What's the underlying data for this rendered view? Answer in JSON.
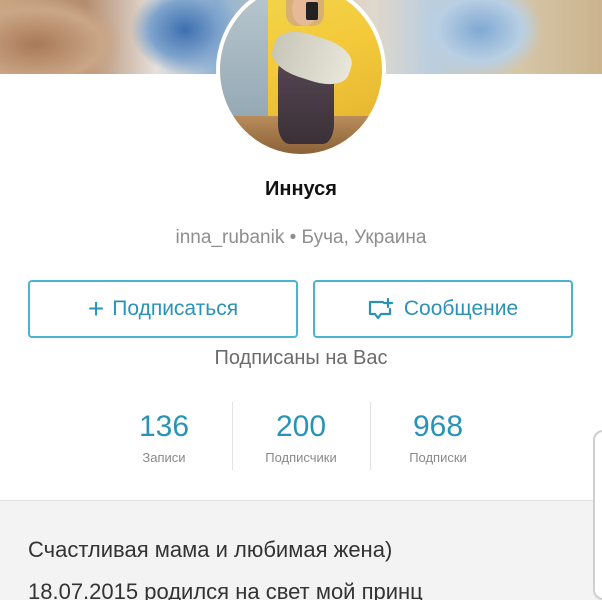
{
  "profile": {
    "name": "Иннуся",
    "username": "inna_rubanik",
    "separator": "•",
    "location": "Буча, Украина",
    "followed_you": "Подписаны на Вас"
  },
  "actions": {
    "follow_label": "Подписаться",
    "follow_icon": "plus-icon",
    "message_label": "Сообщение",
    "message_icon": "chat-bubble-plus-icon"
  },
  "stats": [
    {
      "value": "136",
      "label": "Записи"
    },
    {
      "value": "200",
      "label": "Подписчики"
    },
    {
      "value": "968",
      "label": "Подписки"
    }
  ],
  "bio": {
    "line1": "Счастливая мама и любимая жена)",
    "line2": "18.07.2015 родился на свет мой принц"
  },
  "colors": {
    "accent": "#2a93b5",
    "button_border": "#4cb3cf",
    "muted_text": "#8e8e8e",
    "bio_background": "#f3f3f3"
  }
}
